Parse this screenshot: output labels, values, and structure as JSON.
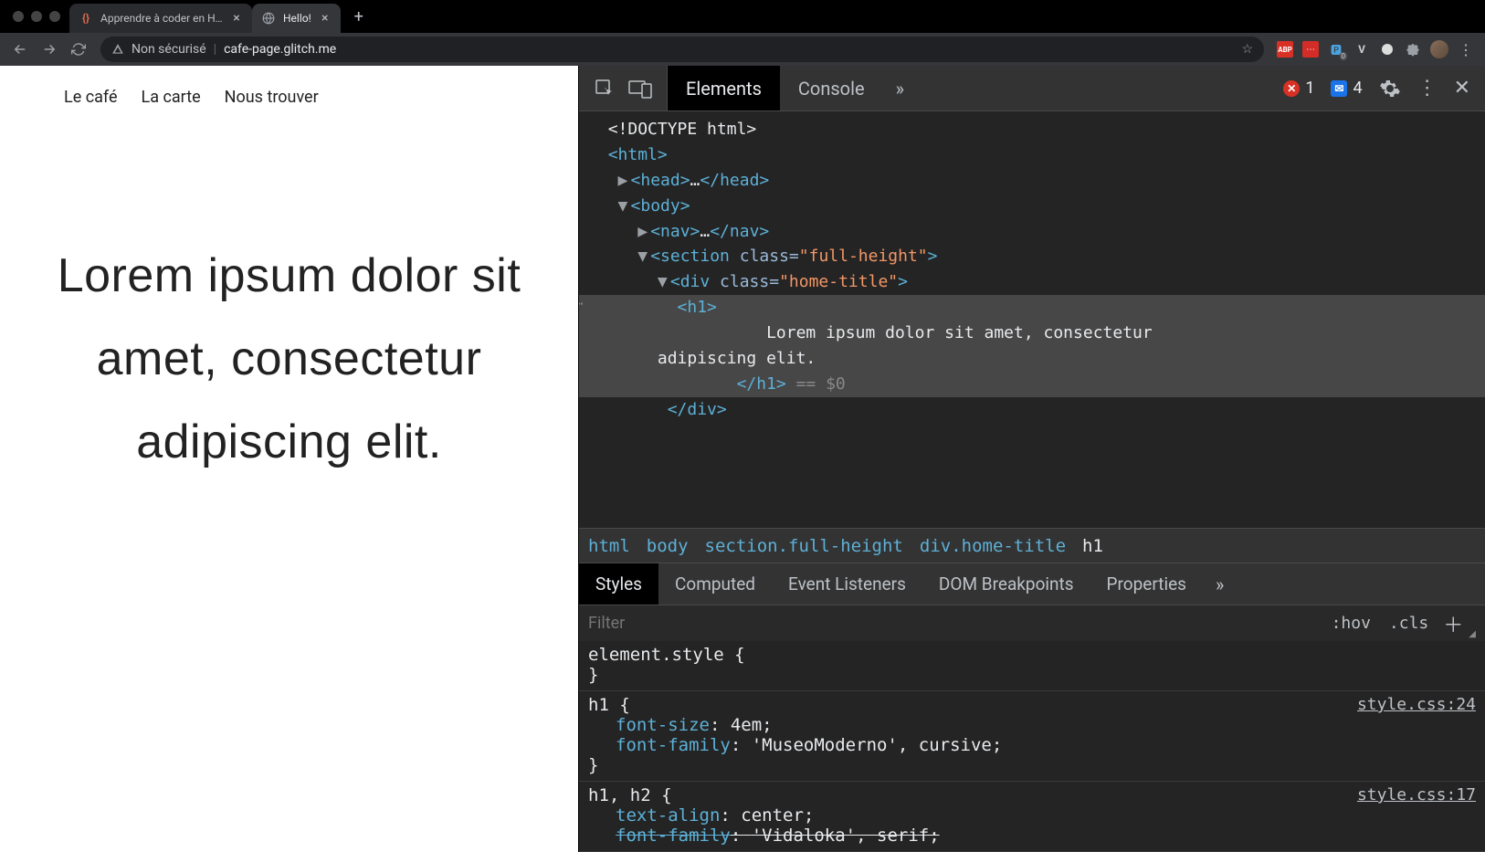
{
  "browser": {
    "tabs": [
      {
        "favicon_color": "#e06c4c",
        "title": "Apprendre à coder en HTML, C",
        "active": false
      },
      {
        "favicon": "globe",
        "title": "Hello!",
        "active": true
      }
    ],
    "omnibox": {
      "security_label": "Non sécurisé",
      "url": "cafe-page.glitch.me"
    },
    "extensions": [
      "ABP",
      "dash",
      "pp",
      "V",
      "circle",
      "puzzle"
    ]
  },
  "page": {
    "nav": [
      "Le café",
      "La carte",
      "Nous trouver"
    ],
    "hero": "Lorem ipsum dolor sit amet, consectetur adipiscing elit."
  },
  "devtools": {
    "tabs": [
      "Elements",
      "Console"
    ],
    "active_tab": "Elements",
    "errors": "1",
    "infos": "4",
    "dom": {
      "doctype": "<!DOCTYPE html>",
      "html_open": "<html>",
      "head": "<head>…</head>",
      "body": "<body>",
      "nav": "<nav>…</nav>",
      "section_open": "<section",
      "section_class_attr": "class",
      "section_class_val": "\"full-height\"",
      "div_open": "<div",
      "div_class_attr": "class",
      "div_class_val": "\"home-title\"",
      "h1_open": "<h1>",
      "h1_text": "Lorem ipsum dolor sit amet, consectetur adipiscing elit.",
      "h1_text_line1": "Lorem ipsum dolor sit amet, consectetur",
      "h1_text_line2": "adipiscing elit.",
      "h1_close": "</h1>",
      "eq0": " == $0",
      "div_close": "</div>"
    },
    "breadcrumbs": [
      "html",
      "body",
      "section.full-height",
      "div.home-title",
      "h1"
    ],
    "styles_tabs": [
      "Styles",
      "Computed",
      "Event Listeners",
      "DOM Breakpoints",
      "Properties"
    ],
    "filter_placeholder": "Filter",
    "hov": ":hov",
    "cls": ".cls",
    "rules": [
      {
        "selector": "element.style {",
        "props": [],
        "close": "}",
        "src": ""
      },
      {
        "selector": "h1 {",
        "props": [
          {
            "p": "font-size",
            "v": "4em;"
          },
          {
            "p": "font-family",
            "v": "'MuseoModerno', cursive;"
          }
        ],
        "close": "}",
        "src": "style.css:24"
      },
      {
        "selector": "h1, h2 {",
        "props": [
          {
            "p": "text-align",
            "v": "center;"
          },
          {
            "p": "font-family",
            "v": "'Vidaloka', serif;",
            "strike": true
          }
        ],
        "close": "",
        "src": "style.css:17"
      }
    ]
  }
}
